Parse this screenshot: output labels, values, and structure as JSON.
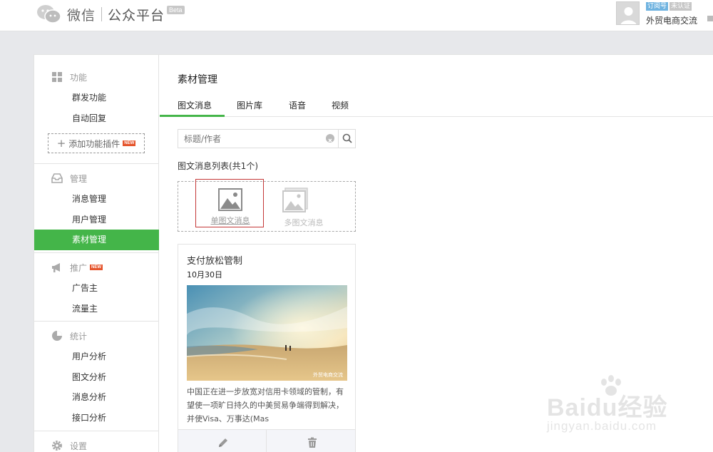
{
  "header": {
    "brand_name": "微信",
    "platform_name": "公众平台",
    "beta_label": "Beta",
    "account_type_tag": "订阅号",
    "verify_tag": "未认证",
    "account_name": "外贸电商交流"
  },
  "sidebar": {
    "groups": [
      {
        "title": "功能",
        "icon": "grid-icon",
        "items": [
          "群发功能",
          "自动回复"
        ]
      },
      {
        "title": "管理",
        "icon": "inbox-icon",
        "items": [
          "消息管理",
          "用户管理",
          "素材管理"
        ]
      },
      {
        "title": "推广",
        "icon": "megaphone-icon",
        "items": [
          "广告主",
          "流量主"
        ]
      },
      {
        "title": "统计",
        "icon": "pie-chart-icon",
        "items": [
          "用户分析",
          "图文分析",
          "消息分析",
          "接口分析"
        ]
      },
      {
        "title": "设置",
        "icon": "gear-icon",
        "items": []
      }
    ],
    "add_plugin_label": "添加功能插件",
    "new_badge": "NEW",
    "active_item": "素材管理"
  },
  "content": {
    "page_title": "素材管理",
    "tabs": [
      "图文消息",
      "图片库",
      "语音",
      "视频"
    ],
    "active_tab": "图文消息",
    "search_placeholder": "标题/作者",
    "list_label": "图文消息列表(共1个)",
    "create_single_label": "单图文消息",
    "create_multi_label": "多图文消息",
    "card": {
      "title": "支付放松管制",
      "date": "10月30日",
      "image_caption": "外贸电商交流",
      "description": "中国正在进一步放宽对信用卡领域的管制，有望使一项旷日持久的中美贸易争端得到解决，并使Visa、万事达(Mas"
    }
  },
  "watermark": {
    "brand": "Baidu经验",
    "url": "jingyan.baidu.com"
  },
  "colors": {
    "accent_green": "#44b549",
    "highlight_red": "#c43737",
    "new_badge": "#e5542c"
  }
}
